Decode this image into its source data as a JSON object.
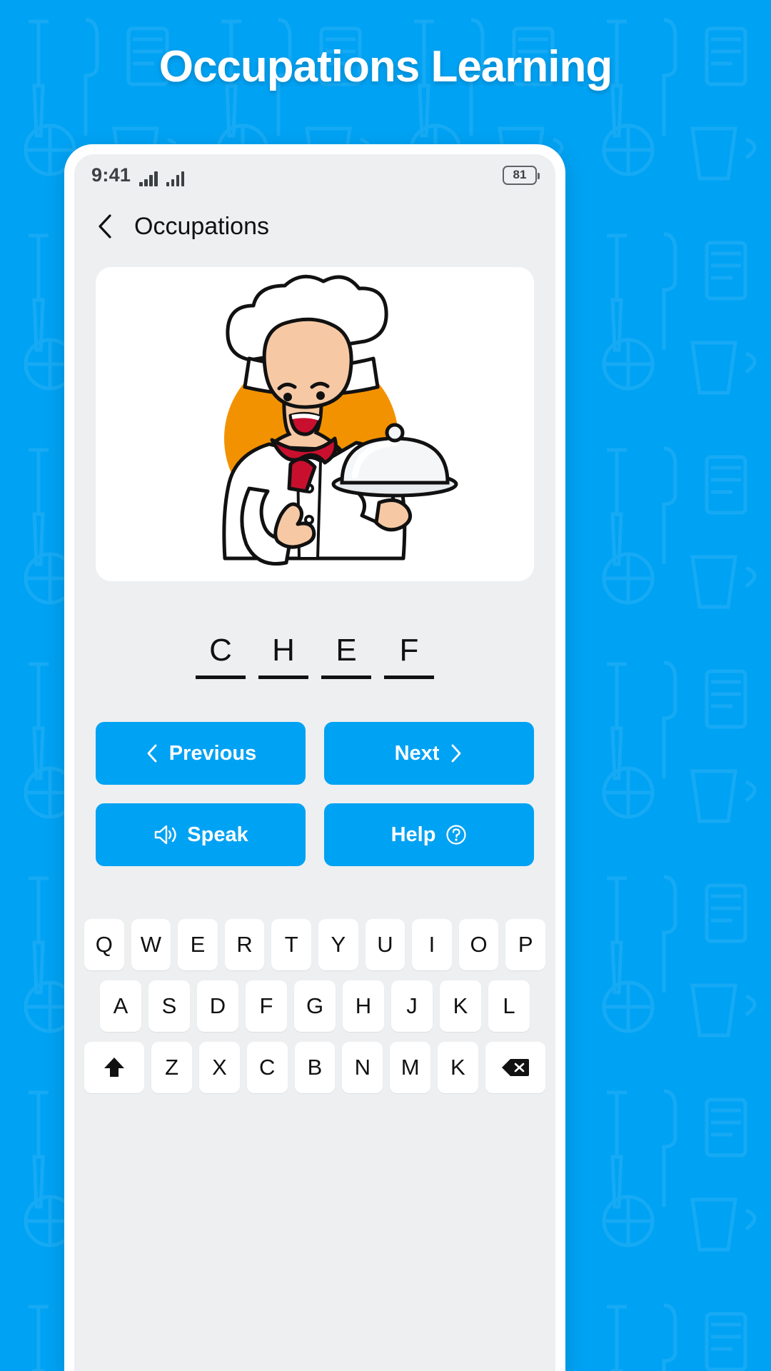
{
  "page": {
    "title": "Occupations Learning",
    "brand_color": "#00a2f3",
    "background_color": "#00a2f3"
  },
  "status_bar": {
    "time": "9:41",
    "signal_icon_1": "signal-bars-icon",
    "signal_icon_2": "signal-bars-icon",
    "battery_level": "81",
    "battery_icon": "battery-icon"
  },
  "nav_bar": {
    "back_icon": "chevron-left-icon",
    "title": "Occupations"
  },
  "card": {
    "illustration_name": "chef-illustration",
    "illustration_alt": "Cartoon chef with hat holding a covered serving tray and giving a thumbs up"
  },
  "word": {
    "answer": "CHEF",
    "letters": [
      "C",
      "H",
      "E",
      "F"
    ]
  },
  "actions": [
    {
      "label": "Previous",
      "icon": "chevron-left-icon",
      "icon_position": "left"
    },
    {
      "label": "Next",
      "icon": "chevron-right-icon",
      "icon_position": "right"
    },
    {
      "label": "Speak",
      "icon": "speaker-icon",
      "icon_position": "left"
    },
    {
      "label": "Help",
      "icon": "question-circle-icon",
      "icon_position": "right"
    }
  ],
  "keyboard": {
    "row1": [
      "Q",
      "W",
      "E",
      "R",
      "T",
      "Y",
      "U",
      "I",
      "O",
      "P"
    ],
    "row2": [
      "A",
      "S",
      "D",
      "F",
      "G",
      "H",
      "J",
      "K",
      "L"
    ],
    "row3_letters": [
      "Z",
      "X",
      "C",
      "B",
      "N",
      "M",
      "K"
    ],
    "shift_icon": "shift-up-arrow-icon",
    "backspace_icon": "backspace-delete-icon"
  }
}
